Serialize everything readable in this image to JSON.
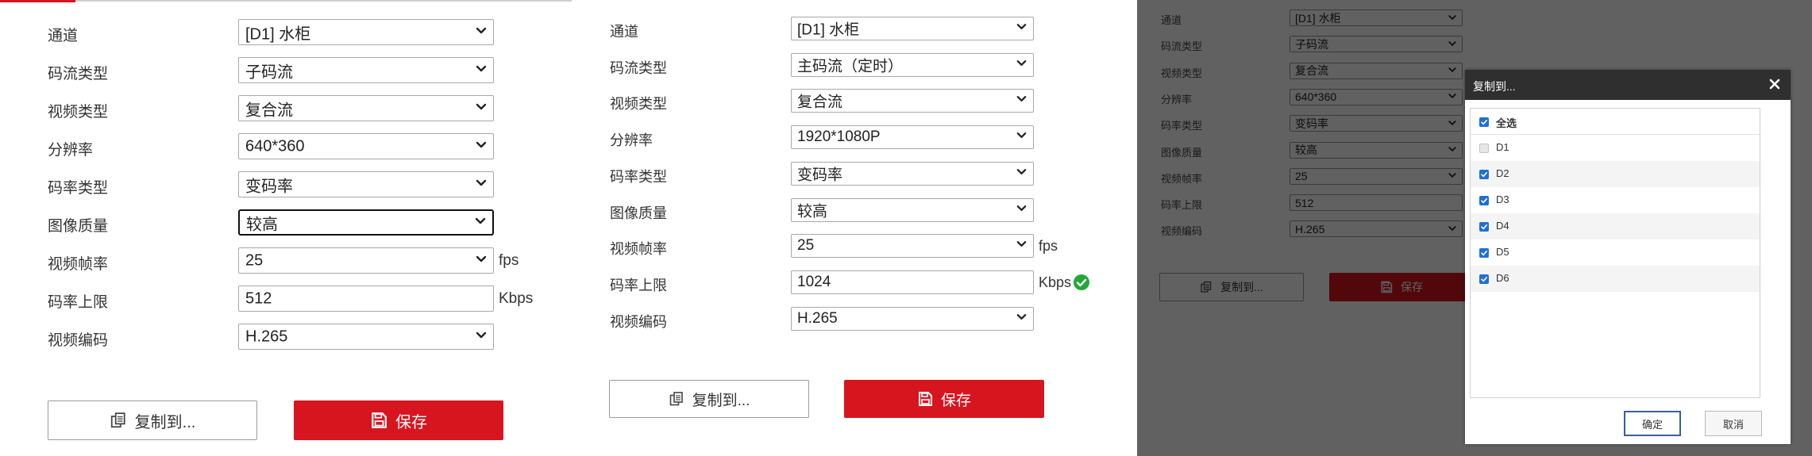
{
  "panel1": {
    "fields": [
      {
        "label": "通道",
        "value": "[D1] 水柜",
        "kind": "select"
      },
      {
        "label": "码流类型",
        "value": "子码流",
        "kind": "select"
      },
      {
        "label": "视频类型",
        "value": "复合流",
        "kind": "select"
      },
      {
        "label": "分辨率",
        "value": "640*360",
        "kind": "select"
      },
      {
        "label": "码率类型",
        "value": "变码率",
        "kind": "select"
      },
      {
        "label": "图像质量",
        "value": "较高",
        "kind": "select",
        "focused": true
      },
      {
        "label": "视频帧率",
        "value": "25",
        "kind": "select",
        "unit": "fps"
      },
      {
        "label": "码率上限",
        "value": "512",
        "kind": "input",
        "unit": "Kbps"
      },
      {
        "label": "视频编码",
        "value": "H.265",
        "kind": "select"
      }
    ],
    "copy_label": "复制到...",
    "save_label": "保存"
  },
  "panel2": {
    "fields": [
      {
        "label": "通道",
        "value": "[D1] 水柜",
        "kind": "select"
      },
      {
        "label": "码流类型",
        "value": "主码流（定时）",
        "kind": "select"
      },
      {
        "label": "视频类型",
        "value": "复合流",
        "kind": "select"
      },
      {
        "label": "分辨率",
        "value": "1920*1080P",
        "kind": "select"
      },
      {
        "label": "码率类型",
        "value": "变码率",
        "kind": "select"
      },
      {
        "label": "图像质量",
        "value": "较高",
        "kind": "select"
      },
      {
        "label": "视频帧率",
        "value": "25",
        "kind": "select",
        "unit": "fps"
      },
      {
        "label": "码率上限",
        "value": "1024",
        "kind": "input",
        "unit": "Kbps",
        "valid": true
      },
      {
        "label": "视频编码",
        "value": "H.265",
        "kind": "select"
      }
    ],
    "copy_label": "复制到...",
    "save_label": "保存"
  },
  "panel3": {
    "fields": [
      {
        "label": "通道",
        "value": "[D1] 水柜",
        "kind": "select"
      },
      {
        "label": "码流类型",
        "value": "子码流",
        "kind": "select"
      },
      {
        "label": "视频类型",
        "value": "复合流",
        "kind": "select"
      },
      {
        "label": "分辨率",
        "value": "640*360",
        "kind": "select"
      },
      {
        "label": "码率类型",
        "value": "变码率",
        "kind": "select"
      },
      {
        "label": "图像质量",
        "value": "较高",
        "kind": "select"
      },
      {
        "label": "视频帧率",
        "value": "25",
        "kind": "select"
      },
      {
        "label": "码率上限",
        "value": "512",
        "kind": "input"
      },
      {
        "label": "视频编码",
        "value": "H.265",
        "kind": "select"
      }
    ],
    "copy_label": "复制到...",
    "save_label": "保存",
    "dialog": {
      "title": "复制到...",
      "select_all": {
        "label": "全选",
        "checked": true
      },
      "items": [
        {
          "label": "D1",
          "checked": true,
          "disabled": true
        },
        {
          "label": "D2",
          "checked": true
        },
        {
          "label": "D3",
          "checked": true
        },
        {
          "label": "D4",
          "checked": true
        },
        {
          "label": "D5",
          "checked": true
        },
        {
          "label": "D6",
          "checked": true
        }
      ],
      "ok_label": "确定",
      "cancel_label": "取消"
    }
  },
  "colors": {
    "accent_red": "#d7151f",
    "check_blue": "#1f6fd6",
    "valid_green": "#22a83a",
    "dialog_header": "#2f2f2f"
  },
  "icons": {
    "copy": "copy-icon",
    "save": "save-icon",
    "dropdown": "chevron-down-icon",
    "valid": "check-circle-icon",
    "close": "close-icon"
  }
}
